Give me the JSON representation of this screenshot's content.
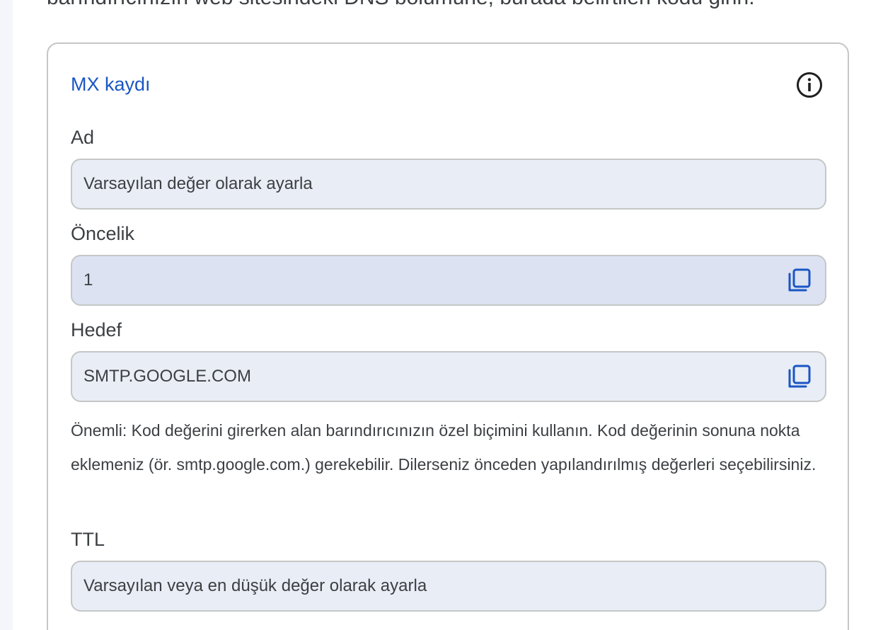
{
  "intro": {
    "text": "barındırıcınızın web sitesindeki DNS bölümüne, burada belirtilen kodu girin."
  },
  "card": {
    "title": "MX kaydı",
    "info_icon": "info-icon"
  },
  "fields": {
    "name": {
      "label": "Ad",
      "value": "Varsayılan değer olarak ayarla"
    },
    "priority": {
      "label": "Öncelik",
      "value": "1",
      "copy_icon": "copy-icon"
    },
    "target": {
      "label": "Hedef",
      "value": "SMTP.GOOGLE.COM",
      "copy_icon": "copy-icon"
    },
    "ttl": {
      "label": "TTL",
      "value": "Varsayılan veya en düşük değer olarak ayarla"
    }
  },
  "note": {
    "text": "Önemli: Kod değerini girerken alan barındırıcınızın özel biçimini kullanın. Kod değerinin sonuna nokta eklemeniz (ör. smtp.google.com.) gerekebilir. Dilerseniz önceden yapılandırılmış değerleri seçebilirsiniz."
  },
  "colors": {
    "accent": "#1a56c4",
    "text": "#3c4043",
    "field_bg": "#e9edf6",
    "field_bg_active": "#dce2f2",
    "border": "#c4c7c5"
  }
}
